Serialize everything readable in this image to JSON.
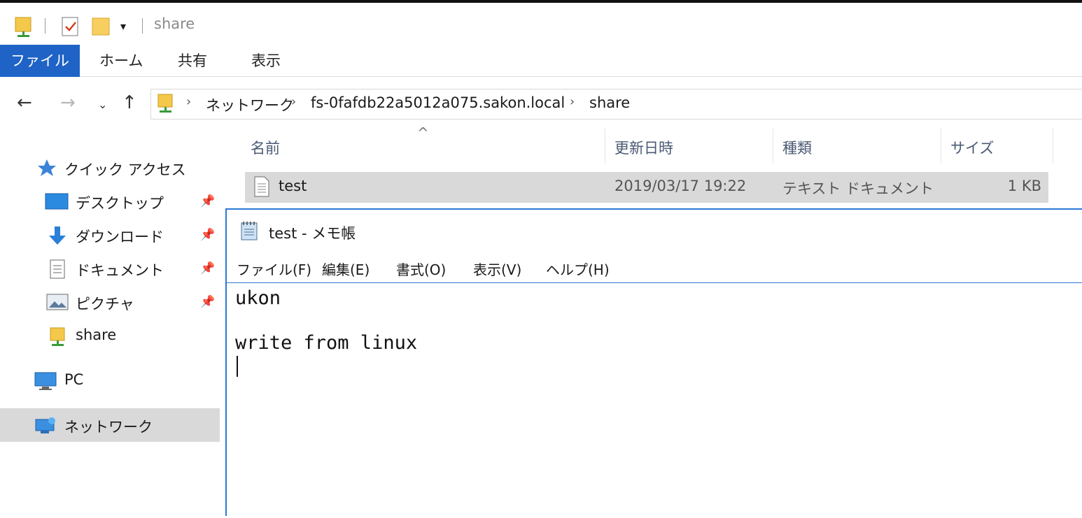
{
  "window": {
    "title": "share"
  },
  "ribbon": {
    "tabs": [
      "ファイル",
      "ホーム",
      "共有",
      "表示"
    ]
  },
  "address": {
    "crumbs": [
      "ネットワーク",
      "fs-0fafdb22a5012a075.sakon.local",
      "share"
    ]
  },
  "nav_pane": {
    "quick_access": "クイック アクセス",
    "desktop": "デスクトップ",
    "downloads": "ダウンロード",
    "documents": "ドキュメント",
    "pictures": "ピクチャ",
    "share": "share",
    "pc": "PC",
    "network": "ネットワーク"
  },
  "file_list": {
    "columns": {
      "name": "名前",
      "modified": "更新日時",
      "type": "種類",
      "size": "サイズ"
    },
    "rows": [
      {
        "name": "test",
        "modified": "2019/03/17 19:22",
        "type": "テキスト ドキュメント",
        "size": "1 KB"
      }
    ]
  },
  "notepad": {
    "title": "test - メモ帳",
    "menu": [
      "ファイル(F)",
      "編集(E)",
      "書式(O)",
      "表示(V)",
      "ヘルプ(H)"
    ],
    "lines": [
      "ukon",
      "",
      "write from linux"
    ]
  },
  "colors": {
    "accent": "#1f63c6",
    "selection": "#d9d9d9",
    "notepad_border": "#2a78d6"
  }
}
